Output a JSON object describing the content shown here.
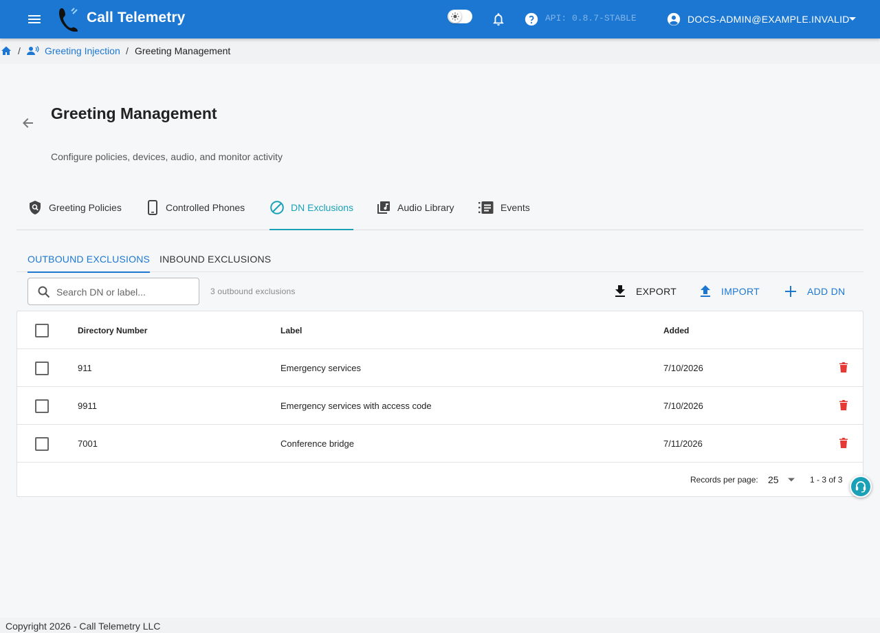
{
  "appbar": {
    "title": "Call Telemetry",
    "api_version": "API: 0.8.7-STABLE",
    "account": "DOCS-ADMIN@EXAMPLE.INVALID",
    "brand_color": "#1c77d2"
  },
  "breadcrumb": {
    "separator": "/",
    "items": [
      {
        "label": "Greeting Injection"
      },
      {
        "label": "Greeting Management"
      }
    ]
  },
  "page": {
    "title": "Greeting Management",
    "subtitle": "Configure policies, devices, audio, and monitor activity"
  },
  "main_tabs": [
    {
      "label": "Greeting Policies",
      "icon": "shield-search-icon"
    },
    {
      "label": "Controlled Phones",
      "icon": "phone-icon"
    },
    {
      "label": "DN Exclusions",
      "icon": "cancel-icon",
      "active": true
    },
    {
      "label": "Audio Library",
      "icon": "music-library-icon"
    },
    {
      "label": "Events",
      "icon": "list-icon"
    }
  ],
  "sub_tabs": [
    {
      "label": "OUTBOUND EXCLUSIONS",
      "active": true
    },
    {
      "label": "INBOUND EXCLUSIONS"
    }
  ],
  "toolbar": {
    "search_placeholder": "Search DN or label...",
    "search_value": "",
    "count_text": "3 outbound exclusions",
    "export_label": "EXPORT",
    "import_label": "IMPORT",
    "add_label": "ADD DN"
  },
  "table": {
    "headers": {
      "dn": "Directory Number",
      "label": "Label",
      "added": "Added"
    },
    "rows": [
      {
        "dn": "911",
        "label": "Emergency services",
        "added": "7/10/2026"
      },
      {
        "dn": "9911",
        "label": "Emergency services with access code",
        "added": "7/10/2026"
      },
      {
        "dn": "7001",
        "label": "Conference bridge",
        "added": "7/11/2026"
      }
    ],
    "delete_color": "#e53935"
  },
  "pager": {
    "label": "Records per page:",
    "per_page": "25",
    "range": "1 - 3 of 3"
  },
  "footer": {
    "text": "Copyright 2026 - Call Telemetry LLC"
  }
}
